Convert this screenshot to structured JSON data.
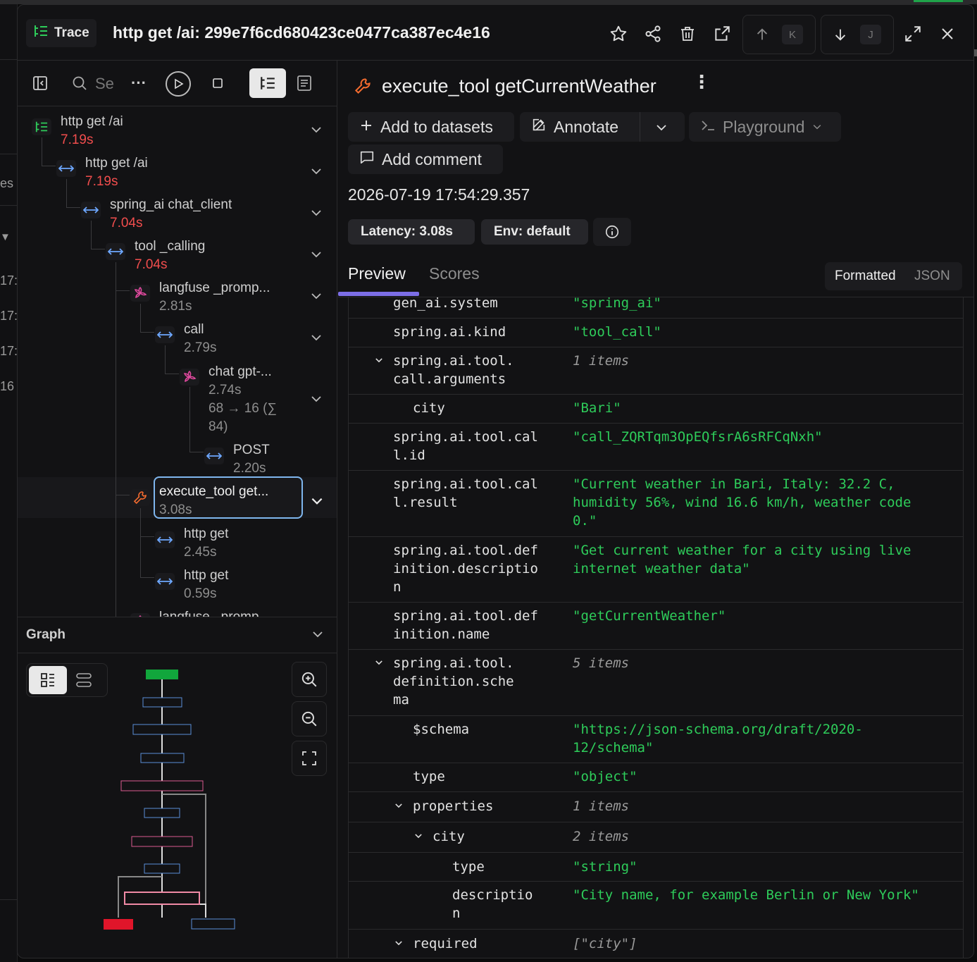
{
  "header": {
    "badge": "Trace",
    "title": "http get /ai: 299e7f6cd680423ce0477ca387ec4e16",
    "kbd_up": "K",
    "kbd_down": "J"
  },
  "gutter": {
    "partial_text": [
      "es",
      "▼",
      "17:",
      "17:",
      "17:",
      "16"
    ]
  },
  "tree_toolbar": {
    "search_label": "Se"
  },
  "tree": [
    {
      "name": "http get /ai",
      "duration": "7.19s"
    },
    {
      "name": "http get /ai",
      "duration": "7.19s"
    },
    {
      "name": "spring_ai chat_client",
      "duration": "7.04s"
    },
    {
      "name": "tool _calling",
      "duration": "7.04s"
    },
    {
      "name": "langfuse _promp...",
      "duration": "2.81s"
    },
    {
      "name": "call",
      "duration": "2.79s"
    },
    {
      "name": "chat gpt-...",
      "duration": "2.74s",
      "tokens1": "68 → 16 (∑",
      "tokens2": "84)"
    },
    {
      "name": "POST",
      "duration": "2.20s"
    },
    {
      "name": "execute_tool get...",
      "duration": "3.08s"
    },
    {
      "name": "http get",
      "duration": "2.45s"
    },
    {
      "name": "http get",
      "duration": "0.59s"
    },
    {
      "name": "langfuse _promp..."
    }
  ],
  "graph": {
    "title": "Graph"
  },
  "detail": {
    "title": "execute_tool getCurrentWeather",
    "add_datasets": "Add to datasets",
    "annotate": "Annotate",
    "playground": "Playground",
    "add_comment": "Add comment",
    "timestamp": "2026-07-19 17:54:29.357",
    "latency": "Latency: 3.08s",
    "env": "Env: default",
    "tab_preview": "Preview",
    "tab_scores": "Scores",
    "fmt_formatted": "Formatted",
    "fmt_json": "JSON"
  },
  "rows": [
    {
      "key": "gen_ai.system",
      "value": "\"spring_ai\""
    },
    {
      "key": "spring.ai.kind",
      "value": "\"tool_call\""
    },
    {
      "key": "spring.ai.tool.\ncall.arguments",
      "value": "1 items"
    },
    {
      "key": "city",
      "value": "\"Bari\""
    },
    {
      "key": "spring.ai.tool.cal\nl.id",
      "value": "\"call_ZQRTqm3OpEQfsrA6sRFCqNxh\""
    },
    {
      "key": "spring.ai.tool.cal\nl.result",
      "value": "\"Current weather in Bari, Italy: 32.2 C,\nhumidity 56%, wind 16.6 km/h, weather code\n0.\""
    },
    {
      "key": "spring.ai.tool.def\ninition.descriptio\nn",
      "value": "\"Get current weather for a city using live\ninternet weather data\""
    },
    {
      "key": "spring.ai.tool.def\ninition.name",
      "value": "\"getCurrentWeather\""
    },
    {
      "key": "spring.ai.tool.\ndefinition.sche\nma",
      "value": "5 items"
    },
    {
      "key": "$schema",
      "value": "\"https://json-schema.org/draft/2020-\n12/schema\""
    },
    {
      "key": "type",
      "value": "\"object\""
    },
    {
      "key": "properties",
      "value": "1 items"
    },
    {
      "key": "city",
      "value": "2 items"
    },
    {
      "key": "type",
      "value": "\"string\""
    },
    {
      "key": "descriptio\nn",
      "value": "\"City name, for example Berlin or New York\""
    },
    {
      "key": "required",
      "value": "[\"city\"]"
    }
  ]
}
